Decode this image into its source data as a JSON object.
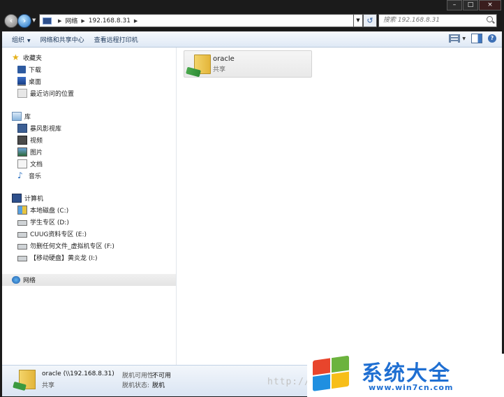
{
  "window": {
    "minimize": "–",
    "maximize": "□",
    "close": "×"
  },
  "address_bar": {
    "breadcrumbs": [
      "网络",
      "192.168.8.31"
    ],
    "search_placeholder": "搜索 192.168.8.31"
  },
  "toolbar": {
    "organize": "组织",
    "network_center": "网络和共享中心",
    "view_printers": "查看远程打印机"
  },
  "nav": {
    "favorites": {
      "label": "收藏夹",
      "items": [
        "下载",
        "桌面",
        "最近访问的位置"
      ]
    },
    "libraries": {
      "label": "库",
      "items": [
        "暴风影视库",
        "视频",
        "图片",
        "文档",
        "音乐"
      ]
    },
    "computer": {
      "label": "计算机",
      "items": [
        "本地磁盘 (C:)",
        "学生专区 (D:)",
        "CUUG资料专区 (E:)",
        "勿删任何文件_虚拟机专区 (F:)",
        "【移动硬盘】黄炎龙 (I:)"
      ]
    },
    "network": {
      "label": "网络"
    }
  },
  "content": {
    "items": [
      {
        "name": "oracle",
        "type": "共享"
      }
    ]
  },
  "details": {
    "name": "oracle (\\\\192.168.8.31)",
    "type": "共享",
    "offline_avail_label": "脱机可用性:",
    "offline_avail_value": "不可用",
    "offline_status_label": "脱机状态:",
    "offline_status_value": "脱机"
  },
  "watermark": {
    "url": "http://",
    "title": "系统大全",
    "site": "www.win7cn.com"
  },
  "colors": {
    "frame": "#1b1b1b",
    "toolbar_text": "#1e395b",
    "logo_blue": "#1f6fd2"
  }
}
